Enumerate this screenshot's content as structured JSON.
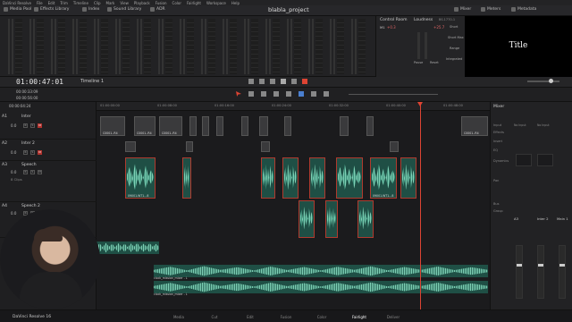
{
  "menubar": [
    "DaVinci Resolve",
    "File",
    "Edit",
    "Trim",
    "Timeline",
    "Clip",
    "Mark",
    "View",
    "Playback",
    "Fusion",
    "Color",
    "Fairlight",
    "Workspace",
    "Help"
  ],
  "toolbar": {
    "left": [
      "Media Pool",
      "Effects Library",
      "Index",
      "Sound Library",
      "ADR"
    ],
    "project": "blabla_project",
    "right": [
      "Mixer",
      "Meters",
      "Metadata"
    ]
  },
  "control": {
    "room": "Control Room",
    "loudness": "Loudness",
    "standard": "BS.1770-1",
    "m1": "M1",
    "short": "Short",
    "short_max": "Short Max",
    "range": "Range",
    "integrated": "Integrated",
    "val1": "+0.3",
    "val2": "+25.7",
    "pause": "Pause",
    "reset": "Reset"
  },
  "viewer": {
    "title": "Title"
  },
  "timecode": "01:00:47:01",
  "timeline_name": "Timeline 1",
  "secondary_tc": [
    "00:00:33:09",
    "00:00:56:00",
    "00:00:04:24"
  ],
  "tracks": [
    {
      "id": "A1",
      "name": "Inter",
      "vol": "0.0",
      "clips_label": ""
    },
    {
      "id": "A2",
      "name": "Inter 2",
      "vol": "0.0",
      "clips_label": ""
    },
    {
      "id": "A3",
      "name": "Speech",
      "vol": "0.0",
      "clips_label": "8 Clips"
    },
    {
      "id": "A4",
      "name": "Speech 2",
      "vol": "0.0",
      "clips_label": ""
    }
  ],
  "ruler": [
    "01:00:00:00",
    "01:00:08:00",
    "01:00:16:00",
    "01:00:24:00",
    "01:00:32:00",
    "01:00:40:00",
    "01:00:48:00"
  ],
  "clip_labels": {
    "gray": "C0001..R4",
    "speech": "09001.WT1...8",
    "bg": "clock_mission_mixer - L"
  },
  "mixer": {
    "title": "Mixer",
    "rows": [
      "Input",
      "Effects",
      "Insert",
      "EQ",
      "Dynamics",
      "Pan",
      "Bus",
      "Group"
    ],
    "channels": [
      "A3",
      "Inter 2",
      "Main 1"
    ],
    "no_input": "No Input"
  },
  "pages": [
    "Media",
    "Cut",
    "Edit",
    "Fusion",
    "Color",
    "Fairlight",
    "Deliver"
  ],
  "active_page": "Fairlight",
  "app_name": "DaVinci Resolve 16",
  "colors": {
    "accent": "#d43",
    "wave": "#7fd0b5",
    "mute": "#b0322e"
  }
}
